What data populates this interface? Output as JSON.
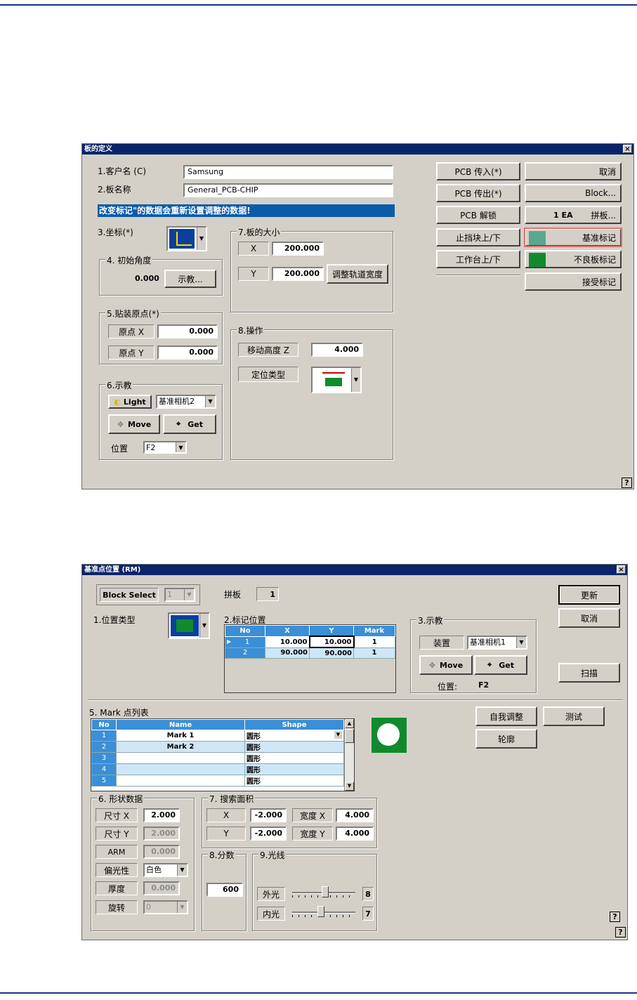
{
  "dlg1": {
    "title": "板的定义",
    "close": "×",
    "help": "?",
    "customer_label": "1.客户名 (C)",
    "customer_value": "Samsung",
    "board_label": "2.板名称",
    "board_value": "General_PCB-CHIP",
    "warning": "改变标记\"的数据会重新设置调整的数据!",
    "coord_label": "3.坐标(*)",
    "angle_group": "4. 初始角度",
    "angle_value": "0.000",
    "teach_btn": "示教...",
    "origin_group": "5.贴装原点(*)",
    "origin_x_label": "原点 X",
    "origin_x_value": "0.000",
    "origin_y_label": "原点 Y",
    "origin_y_value": "0.000",
    "teach_group": "6.示教",
    "light_btn": "Light",
    "camera_value": "基准相机2",
    "move_btn": "Move",
    "get_btn": "Get",
    "position_label": "位置",
    "position_value": "F2",
    "size_group": "7.板的大小",
    "x_label": "X",
    "x_value": "200.000",
    "y_label": "Y",
    "y_value": "200.000",
    "adjust_btn": "调整轨道宽度",
    "op_group": "8.操作",
    "move_z_label": "移动高度 Z",
    "move_z_value": "4.000",
    "locate_label": "定位类型",
    "buttons_left": [
      "PCB 传入(*)",
      "PCB 传出(*)",
      "PCB 解锁",
      "止挡块上/下",
      "工作台上/下"
    ],
    "cancel_btn": "取消",
    "block_btn": "Block...",
    "panel_count": "1 EA",
    "panel_btn": "拼板...",
    "fiducial_btn": "基准标记",
    "bad_mark_btn": "不良板标记",
    "accept_mark_btn": "接受标记"
  },
  "dlg2": {
    "title": "基准点位置 (RM)",
    "close": "×",
    "help": "?",
    "block_select_label": "Block Select",
    "block_select_value": "1",
    "panel_label": "拼板",
    "panel_value": "1",
    "update_btn": "更新",
    "cancel_btn": "取消",
    "scan_btn": "扫描",
    "pos_type_label": "1.位置类型",
    "mark_pos_group": "2.标记位置",
    "mark_pos_headers": [
      "No",
      "X",
      "Y",
      "Mark"
    ],
    "mark_pos_rows": [
      {
        "no": "1",
        "x": "10.000",
        "y": "10.000",
        "mark": "1"
      },
      {
        "no": "2",
        "x": "90.000",
        "y": "90.000",
        "mark": "1"
      }
    ],
    "teach_group": "3.示教",
    "device_label": "装置",
    "camera_value": "基准相机1",
    "move_btn": "Move",
    "get_btn": "Get",
    "position_label": "位置:",
    "position_value": "F2",
    "mark_list_label": "5. Mark 点列表",
    "mark_list_headers": [
      "No",
      "Name",
      "Shape"
    ],
    "mark_list_rows": [
      {
        "no": "1",
        "name": "Mark 1",
        "shape": "圆形"
      },
      {
        "no": "2",
        "name": "Mark 2",
        "shape": "圆形"
      },
      {
        "no": "3",
        "name": "",
        "shape": "圆形"
      },
      {
        "no": "4",
        "name": "",
        "shape": "圆形"
      },
      {
        "no": "5",
        "name": "",
        "shape": "圆形"
      }
    ],
    "self_adjust_btn": "自我调整",
    "test_btn": "测试",
    "contour_btn": "轮廓",
    "shape_group": "6. 形状数据",
    "size_x_label": "尺寸 X",
    "size_x_value": "2.000",
    "size_y_label": "尺寸 Y",
    "size_y_value": "2.000",
    "arm_label": "ARM",
    "arm_value": "0.000",
    "polarity_label": "偏光性",
    "polarity_value": "白色",
    "thickness_label": "厚度",
    "thickness_value": "0.000",
    "rotation_label": "旋转",
    "rotation_value": "0",
    "search_group": "7. 搜索面积",
    "search_x_label": "X",
    "search_x_value": "-2.000",
    "width_x_label": "宽度 X",
    "width_x_value": "4.000",
    "search_y_label": "Y",
    "search_y_value": "-2.000",
    "width_y_label": "宽度 Y",
    "width_y_value": "4.000",
    "score_group": "8.分数",
    "score_value": "600",
    "light_group": "9.光线",
    "outer_label": "外光",
    "outer_value": "8",
    "inner_label": "内光",
    "inner_value": "7"
  },
  "colors": {
    "title_bar": "#0a246a",
    "grid_header": "#3a8fd6",
    "fiducial_green": "#118a2e",
    "highlight_border": "#e0736c"
  }
}
